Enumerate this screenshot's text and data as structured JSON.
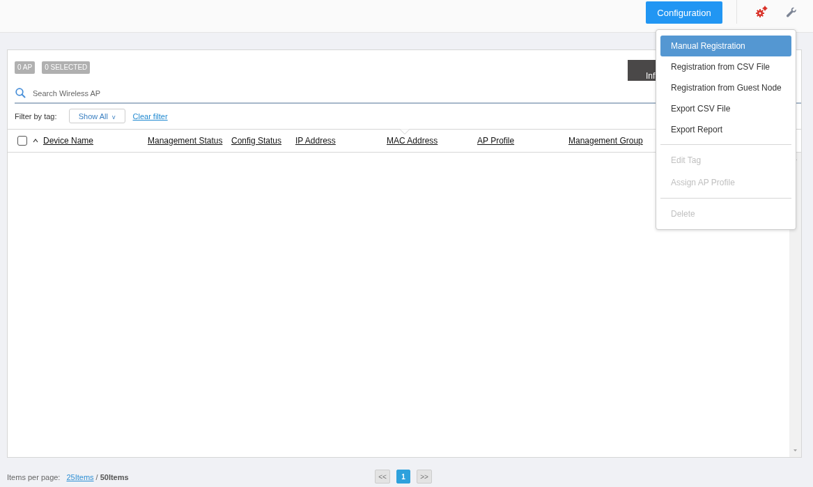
{
  "top_bar": {
    "configuration_button": "Configuration"
  },
  "panel": {
    "badges": [
      "0 AP",
      "0 SELECTED"
    ],
    "dark_button": "Inf",
    "search": {
      "placeholder": "Search Wireless AP"
    },
    "filter": {
      "label": "Filter by tag:",
      "value": "Show All",
      "caret": "v",
      "clear_link": "Clear filter"
    },
    "table": {
      "select_all_checked": false,
      "columns": [
        {
          "label": "Device Name",
          "sorted": true
        },
        {
          "label": "Management Status",
          "sorted": false
        },
        {
          "label": "Config Status",
          "sorted": false
        },
        {
          "label": "IP Address",
          "sorted": false
        },
        {
          "label": "MAC Address",
          "sorted": false
        },
        {
          "label": "AP Profile",
          "sorted": false
        },
        {
          "label": "Management Group",
          "sorted": false
        }
      ]
    }
  },
  "menu": [
    {
      "kind": "item",
      "label": "Manual Registration",
      "selected": true,
      "disabled": false
    },
    {
      "kind": "item",
      "label": "Registration from CSV File",
      "selected": false,
      "disabled": false
    },
    {
      "kind": "item",
      "label": "Registration from Guest Node",
      "selected": false,
      "disabled": false
    },
    {
      "kind": "item",
      "label": "Export CSV File",
      "selected": false,
      "disabled": false
    },
    {
      "kind": "item",
      "label": "Export Report",
      "selected": false,
      "disabled": false
    },
    {
      "kind": "separator"
    },
    {
      "kind": "item",
      "label": "Edit Tag",
      "selected": false,
      "disabled": true
    },
    {
      "kind": "item",
      "label": "Assign AP Profile",
      "selected": false,
      "disabled": true
    },
    {
      "kind": "separator"
    },
    {
      "kind": "item",
      "label": "Delete",
      "selected": false,
      "disabled": true
    }
  ],
  "footer": {
    "label": "Items per page:",
    "options": [
      {
        "label": "25Items",
        "selected": false
      },
      {
        "label": "50Items",
        "selected": true
      }
    ],
    "slash": "/",
    "pagination": {
      "prev": "<<",
      "pages": [
        {
          "label": "1",
          "selected": true
        }
      ],
      "next": ">>"
    }
  }
}
